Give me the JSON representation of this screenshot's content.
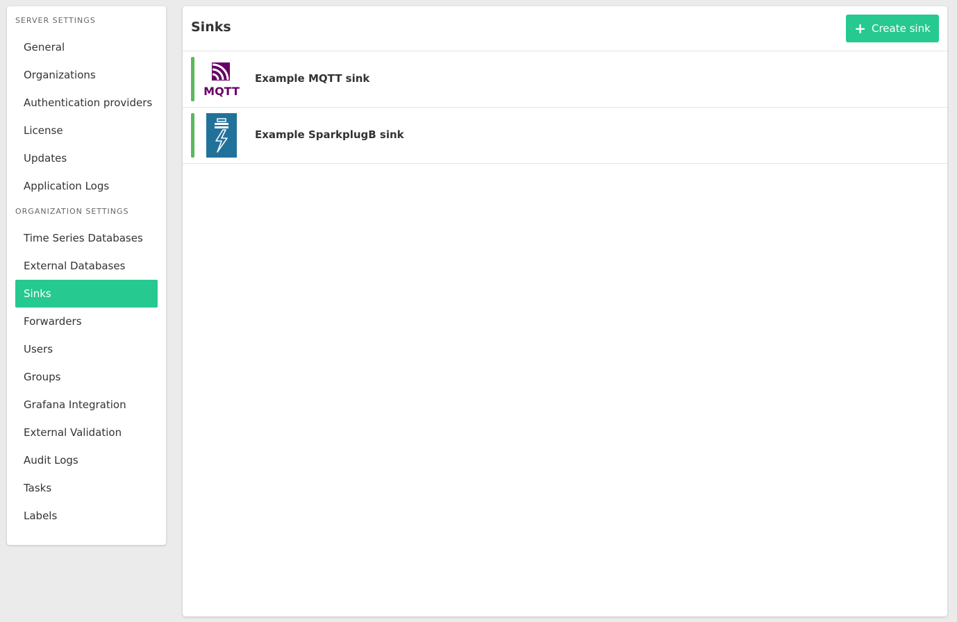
{
  "sidebar": {
    "server_section": "Server Settings",
    "server_items": [
      {
        "label": "General"
      },
      {
        "label": "Organizations"
      },
      {
        "label": "Authentication providers"
      },
      {
        "label": "License"
      },
      {
        "label": "Updates"
      },
      {
        "label": "Application Logs"
      }
    ],
    "org_section": "Organization Settings",
    "org_items": [
      {
        "label": "Time Series Databases"
      },
      {
        "label": "External Databases"
      },
      {
        "label": "Sinks",
        "active": true
      },
      {
        "label": "Forwarders"
      },
      {
        "label": "Users"
      },
      {
        "label": "Groups"
      },
      {
        "label": "Grafana Integration"
      },
      {
        "label": "External Validation"
      },
      {
        "label": "Audit Logs"
      },
      {
        "label": "Tasks"
      },
      {
        "label": "Labels"
      }
    ]
  },
  "main": {
    "title": "Sinks",
    "create_button_label": "Create sink",
    "sinks": [
      {
        "name": "Example MQTT sink",
        "icon": "mqtt-logo-icon",
        "mqtt_logo_text": "MQTT",
        "status_color": "#5cb85c"
      },
      {
        "name": "Example SparkplugB sink",
        "icon": "sparkplug-logo-icon",
        "status_color": "#5cb85c"
      }
    ]
  },
  "colors": {
    "accent": "#26c98f",
    "status_ok": "#5cb85c",
    "mqtt_purple": "#660066",
    "sparkplug_blue": "#21729b"
  }
}
